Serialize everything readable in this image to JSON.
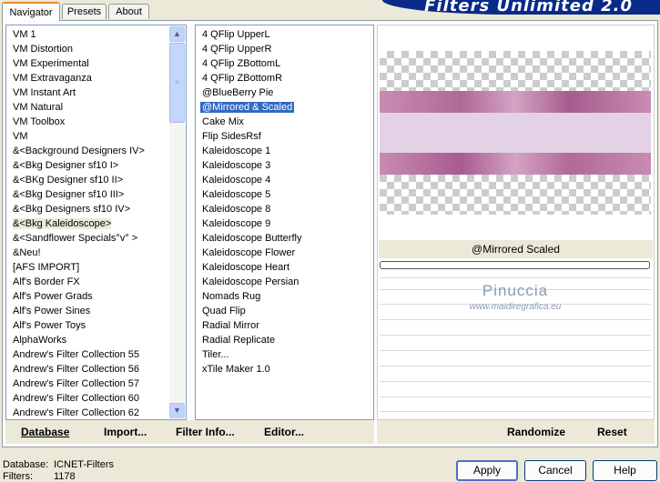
{
  "tabs": [
    {
      "label": "Navigator",
      "active": true
    },
    {
      "label": "Presets",
      "active": false
    },
    {
      "label": "About",
      "active": false
    }
  ],
  "app_title": "Filters Unlimited 2.0",
  "categories": [
    "VM 1",
    "VM Distortion",
    "VM Experimental",
    "VM Extravaganza",
    "VM Instant Art",
    "VM Natural",
    "VM Toolbox",
    "VM",
    "&<Background Designers IV>",
    "&<Bkg Designer sf10 I>",
    "&<BKg Designer sf10 II>",
    "&<Bkg Designer sf10 III>",
    "&<Bkg Designers sf10 IV>",
    "&<Bkg Kaleidoscope>",
    "&<Sandflower Specials°v° >",
    "&Neu!",
    "[AFS IMPORT]",
    "Alf's Border FX",
    "Alf's Power Grads",
    "Alf's Power Sines",
    "Alf's Power Toys",
    "AlphaWorks",
    "Andrew's Filter Collection 55",
    "Andrew's Filter Collection 56",
    "Andrew's Filter Collection 57",
    "Andrew's Filter Collection 60",
    "Andrew's Filter Collection 62"
  ],
  "selected_category": "&<Bkg Kaleidoscope>",
  "filters": [
    "4 QFlip UpperL",
    "4 QFlip UpperR",
    "4 QFlip ZBottomL",
    "4 QFlip ZBottomR",
    "@BlueBerry Pie",
    "@Mirrored & Scaled",
    "Cake Mix",
    "Flip SidesRsf",
    "Kaleidoscope 1",
    "Kaleidoscope 3",
    "Kaleidoscope 4",
    "Kaleidoscope 5",
    "Kaleidoscope 8",
    "Kaleidoscope 9",
    "Kaleidoscope Butterfly",
    "Kaleidoscope Flower",
    "Kaleidoscope Heart",
    "Kaleidoscope Persian",
    "Nomads Rug",
    "Quad Flip",
    "Radial Mirror",
    "Radial Replicate",
    "Tiler...",
    "xTile Maker 1.0"
  ],
  "selected_filter": "@Mirrored & Scaled",
  "preview": {
    "filter_name": "@Mirrored  Scaled",
    "watermark_name": "Pinuccia",
    "watermark_url": "www.maidiregrafica.eu"
  },
  "bottom_links": {
    "database": "Database",
    "import": "Import...",
    "filter_info": "Filter Info...",
    "editor": "Editor...",
    "randomize": "Randomize",
    "reset": "Reset"
  },
  "status": {
    "database_label": "Database:",
    "database_value": "ICNET-Filters",
    "filters_label": "Filters:",
    "filters_value": "1178"
  },
  "buttons": {
    "apply": "Apply",
    "cancel": "Cancel",
    "help": "Help"
  },
  "icons": {
    "scroll_up": "chevron-up-icon",
    "scroll_down": "chevron-down-icon",
    "scroll_thumb_grip": "grip-icon"
  },
  "colors": {
    "selection": "#316ac5",
    "title_bar": "#0a2a8a",
    "preview_band": "#b06a98",
    "preview_center": "#e3d2e6"
  }
}
